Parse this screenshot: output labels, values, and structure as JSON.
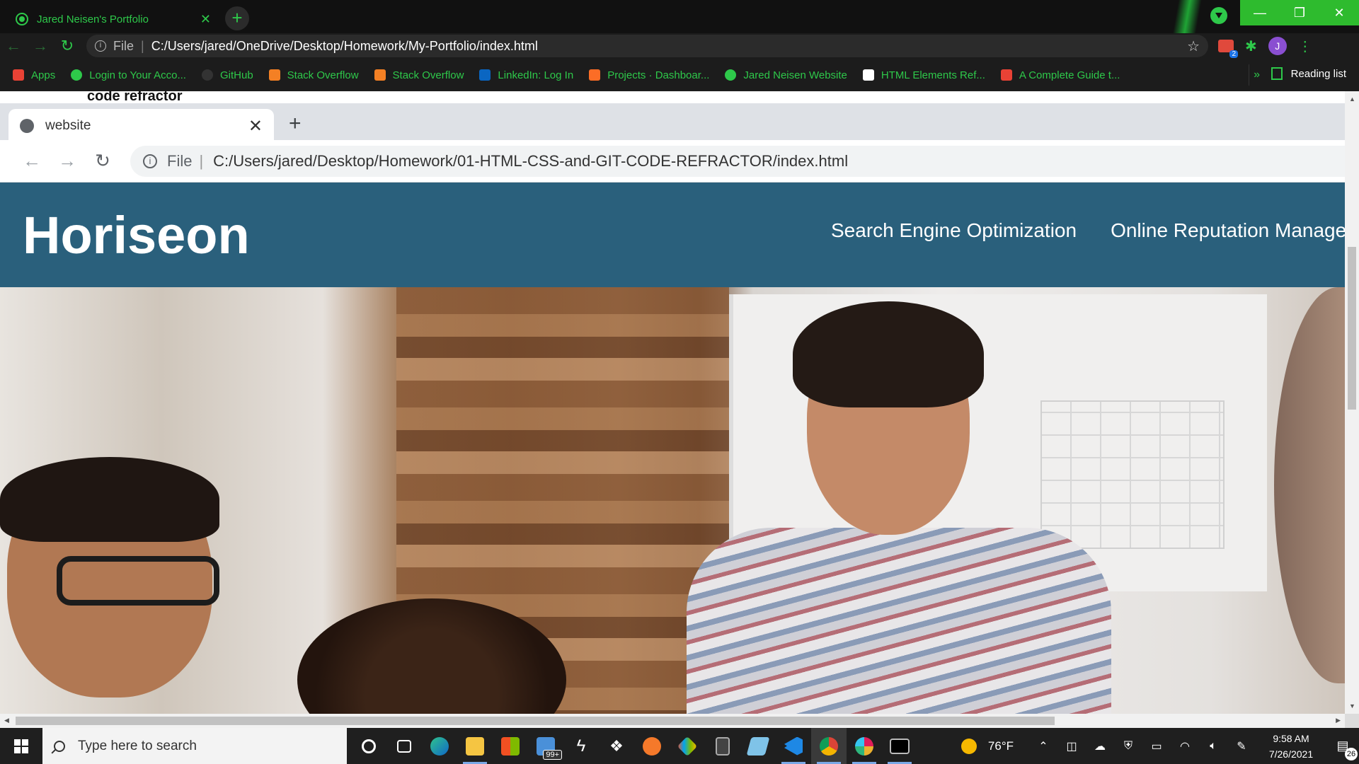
{
  "outer_browser": {
    "tab_title": "Jared Neisen's Portfolio",
    "tab_close": "✕",
    "new_tab": "+",
    "url_scheme": "File",
    "url": "C:/Users/jared/OneDrive/Desktop/Homework/My-Portfolio/index.html",
    "window_controls": [
      "—",
      "❐",
      "✕"
    ],
    "profile_initial": "J",
    "extension_badge": "2",
    "accent_color": "#2ec84a"
  },
  "bookmarks": {
    "items": [
      {
        "label": "Apps",
        "icon": "apps-grid-icon",
        "color": "#e94235"
      },
      {
        "label": "Login to Your Acco...",
        "icon": "globe-icon",
        "color": "#2ec84a"
      },
      {
        "label": "GitHub",
        "icon": "github-icon",
        "color": "#333333"
      },
      {
        "label": "Stack Overflow",
        "icon": "stackoverflow-icon",
        "color": "#f48024"
      },
      {
        "label": "Stack Overflow",
        "icon": "stackoverflow-icon",
        "color": "#f48024"
      },
      {
        "label": "LinkedIn: Log In",
        "icon": "linkedin-icon",
        "color": "#0a66c2"
      },
      {
        "label": "Projects · Dashboar...",
        "icon": "gitlab-icon",
        "color": "#fc6d26"
      },
      {
        "label": "Jared Neisen Website",
        "icon": "globe-icon",
        "color": "#2ec84a"
      },
      {
        "label": "HTML Elements Ref...",
        "icon": "mdn-icon",
        "color": "#ffffff"
      },
      {
        "label": "A Complete Guide t...",
        "icon": "asterisk-icon",
        "color": "#e94235"
      }
    ],
    "more": "»",
    "reading_list": "Reading list"
  },
  "caption": "code refractor",
  "inner_browser": {
    "tab_title": "website",
    "tab_close": "✕",
    "new_tab": "+",
    "url_scheme": "File",
    "url": "C:/Users/jared/Desktop/Homework/01-HTML-CSS-and-GIT-CODE-REFRACTOR/index.html"
  },
  "site": {
    "logo": "Horiseon",
    "nav": [
      "Search Engine Optimization",
      "Online Reputation Manage"
    ],
    "header_color": "#2a607c"
  },
  "taskbar": {
    "search_placeholder": "Type here to search",
    "mail_badge": "99+",
    "weather": "76°F",
    "time": "9:58 AM",
    "date": "7/26/2021",
    "notification_count": "26"
  }
}
